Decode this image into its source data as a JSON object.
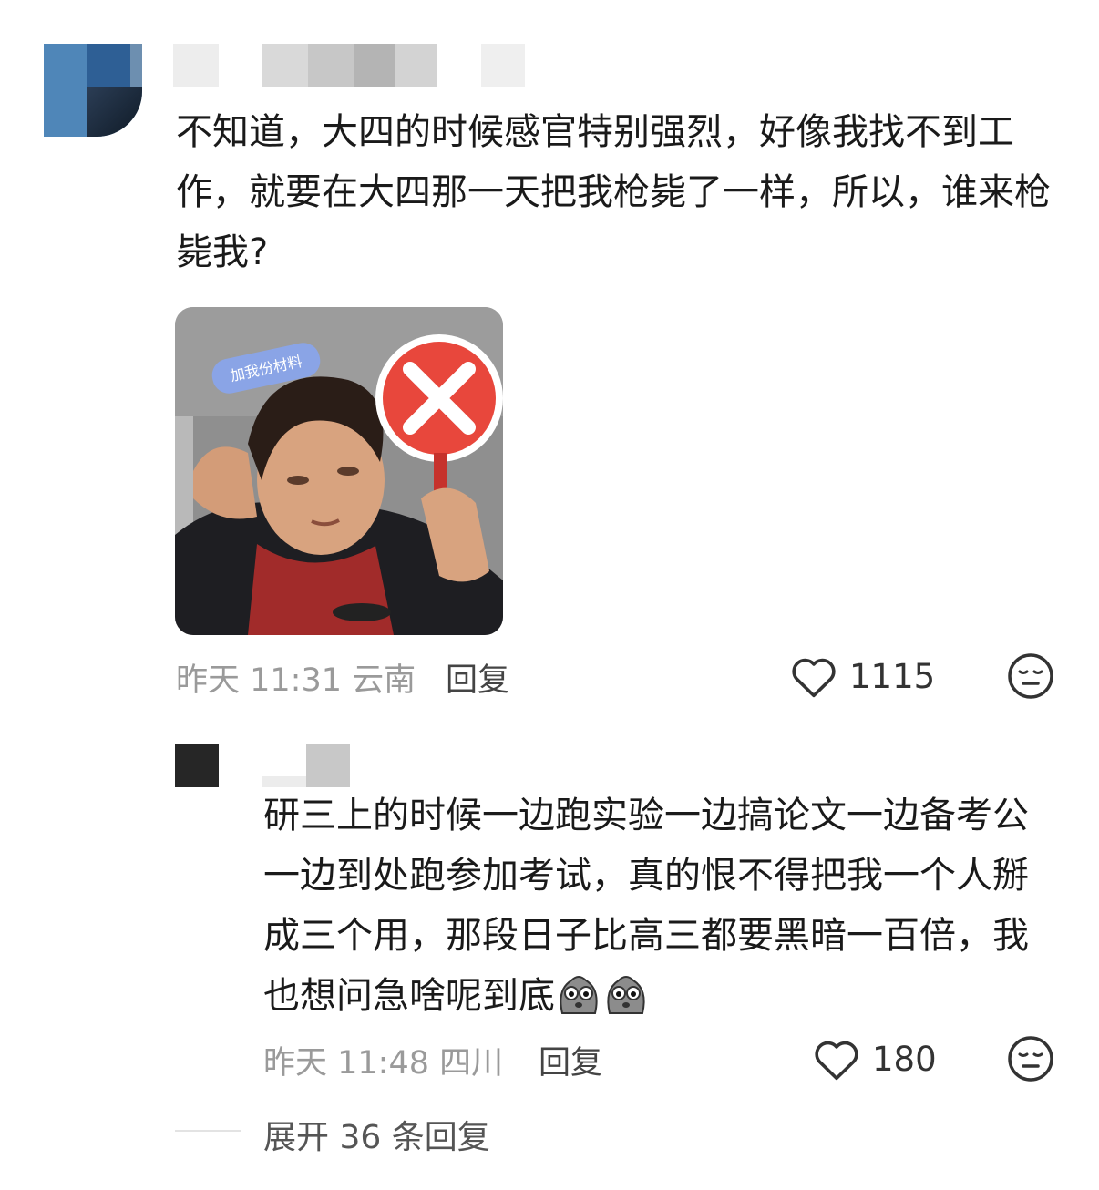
{
  "comment": {
    "text": "不知道，大四的时候感官特别强烈，好像我找不到工作，就要在大四那一天把我枪毙了一样，所以，谁来枪毙我?",
    "image_sticker_text": "加我份材料",
    "time": "昨天 11:31",
    "location": "云南",
    "reply_label": "回复",
    "likes": "1115"
  },
  "reply": {
    "text": "研三上的时候一边跑实验一边搞论文一边备考公一边到处跑参加考试，真的恨不得把我一个人掰成三个用，那段日子比高三都要黑暗一百倍，我也想问急啥呢到底",
    "time": "昨天 11:48",
    "location": "四川",
    "reply_label": "回复",
    "likes": "180"
  },
  "expand": {
    "label": "展开 36 条回复"
  },
  "icons": {
    "like": "heart-outline-icon",
    "emoji": "neutral-face-icon",
    "inline_emoji": "sad-bean-emoji"
  },
  "colors": {
    "text": "#1a1a1a",
    "meta": "#9a9a9a",
    "sign_red": "#e8473c"
  }
}
